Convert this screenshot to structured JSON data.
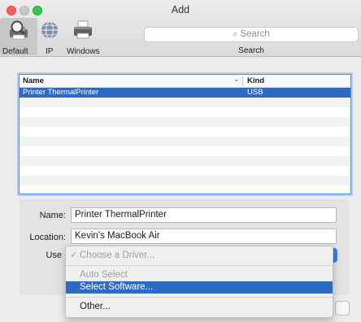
{
  "window": {
    "title": "Add"
  },
  "toolbar": {
    "items": [
      {
        "label": "Default",
        "icon": "default-printer-icon"
      },
      {
        "label": "IP",
        "icon": "globe-icon"
      },
      {
        "label": "Windows",
        "icon": "windows-printer-icon"
      }
    ],
    "search": {
      "placeholder": "Search",
      "label": "Search"
    }
  },
  "printer_list": {
    "columns": {
      "name": "Name",
      "kind": "Kind"
    },
    "rows": [
      {
        "name": "Printer ThermalPrinter",
        "kind": "USB",
        "selected": true
      }
    ]
  },
  "form": {
    "name_label": "Name:",
    "name_value": "Printer ThermalPrinter",
    "location_label": "Location:",
    "location_value": "Kevin’s MacBook Air",
    "use_label": "Use"
  },
  "driver_menu": {
    "checkmark": "✓",
    "choose": "Choose a Driver...",
    "auto_select": "Auto Select",
    "select_software": "Select Software...",
    "other": "Other..."
  },
  "colors": {
    "selection": "#2f6ac2",
    "accent": "#3b7ef0",
    "close": "#fc605c",
    "zoom": "#34c84a"
  }
}
